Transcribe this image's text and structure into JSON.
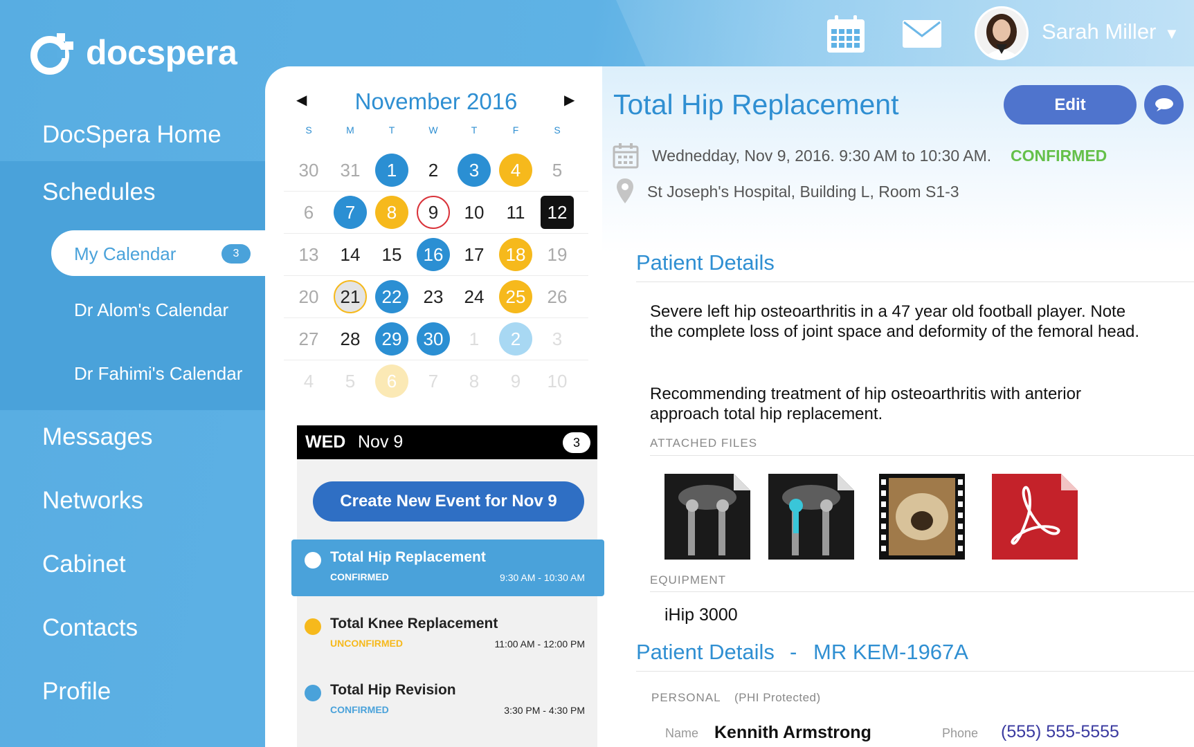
{
  "app": {
    "logo_text": "docspera"
  },
  "header": {
    "user_name": "Sarah Miller",
    "caret": "▼"
  },
  "sidebar": {
    "items": [
      {
        "label": "DocSpera Home"
      },
      {
        "label": "Schedules"
      },
      {
        "label": "Messages"
      },
      {
        "label": "Networks"
      },
      {
        "label": "Cabinet"
      },
      {
        "label": "Contacts"
      },
      {
        "label": "Profile"
      }
    ],
    "sub_items": [
      {
        "label": "My Calendar",
        "badge": "3"
      },
      {
        "label": "Dr Alom's Calendar"
      },
      {
        "label": "Dr Fahimi's Calendar"
      }
    ]
  },
  "calendar": {
    "title": "November 2016",
    "prev": "◀",
    "next": "▶",
    "weekdays": [
      "S",
      "M",
      "T",
      "W",
      "T",
      "F",
      "S"
    ],
    "weeks": [
      [
        {
          "d": "30",
          "s": "muted"
        },
        {
          "d": "31",
          "s": "muted"
        },
        {
          "d": "1",
          "s": "blue"
        },
        {
          "d": "2",
          "s": ""
        },
        {
          "d": "3",
          "s": "blue"
        },
        {
          "d": "4",
          "s": "yellow"
        },
        {
          "d": "5",
          "s": "muted"
        }
      ],
      [
        {
          "d": "6",
          "s": "muted"
        },
        {
          "d": "7",
          "s": "blue"
        },
        {
          "d": "8",
          "s": "yellow"
        },
        {
          "d": "9",
          "s": "redring"
        },
        {
          "d": "10",
          "s": ""
        },
        {
          "d": "11",
          "s": ""
        },
        {
          "d": "12",
          "s": "sel"
        }
      ],
      [
        {
          "d": "13",
          "s": "muted"
        },
        {
          "d": "14",
          "s": ""
        },
        {
          "d": "15",
          "s": ""
        },
        {
          "d": "16",
          "s": "blue"
        },
        {
          "d": "17",
          "s": ""
        },
        {
          "d": "18",
          "s": "yellow"
        },
        {
          "d": "19",
          "s": "muted"
        }
      ],
      [
        {
          "d": "20",
          "s": "muted"
        },
        {
          "d": "21",
          "s": "today"
        },
        {
          "d": "22",
          "s": "blue"
        },
        {
          "d": "23",
          "s": ""
        },
        {
          "d": "24",
          "s": ""
        },
        {
          "d": "25",
          "s": "yellow"
        },
        {
          "d": "26",
          "s": "muted"
        }
      ],
      [
        {
          "d": "27",
          "s": "muted"
        },
        {
          "d": "28",
          "s": ""
        },
        {
          "d": "29",
          "s": "blue"
        },
        {
          "d": "30",
          "s": "blue"
        },
        {
          "d": "1",
          "s": "faint"
        },
        {
          "d": "2",
          "s": "ltblue"
        },
        {
          "d": "3",
          "s": "faint"
        }
      ],
      [
        {
          "d": "4",
          "s": "faint"
        },
        {
          "d": "5",
          "s": "faint"
        },
        {
          "d": "6",
          "s": "ltyellow"
        },
        {
          "d": "7",
          "s": "faint"
        },
        {
          "d": "8",
          "s": "faint"
        },
        {
          "d": "9",
          "s": "faint"
        },
        {
          "d": "10",
          "s": "faint"
        }
      ]
    ]
  },
  "day_list": {
    "weekday": "WED",
    "date": "Nov 9",
    "count": "3",
    "create_label": "Create New Event for Nov 9",
    "events": [
      {
        "title": "Total Hip Replacement",
        "status": "CONFIRMED",
        "time": "9:30 AM - 10:30 AM",
        "dot_color": "#ffffff",
        "status_color": "#ffffff"
      },
      {
        "title": "Total Knee Replacement",
        "status": "UNCONFIRMED",
        "time": "11:00 AM - 12:00 PM",
        "dot_color": "#f6b91c",
        "status_color": "#f6b91c"
      },
      {
        "title": "Total Hip Revision",
        "status": "CONFIRMED",
        "time": "3:30 PM - 4:30 PM",
        "dot_color": "#4aa2da",
        "status_color": "#4aa2da"
      }
    ]
  },
  "detail": {
    "title": "Total Hip Replacement",
    "edit_label": "Edit",
    "date_text": "Wednedday, Nov 9, 2016.  9:30 AM to 10:30 AM.",
    "status": "CONFIRMED",
    "location": "St Joseph's Hospital, Building L, Room S1-3",
    "patient_details_title": "Patient Details",
    "para1": "Severe left hip osteoarthritis in a 47 year old football player. Note the complete loss of joint space and deformity of the femoral head.",
    "para2": "Recommending treatment of hip osteoarthritis with anterior approach total hip replacement.",
    "attached_files_caption": "ATTACHED FILES",
    "files": [
      "xray-file-icon",
      "xray-implant-file-icon",
      "ct-video-file-icon",
      "pdf-file-icon"
    ],
    "equipment_caption": "EQUIPMENT",
    "equipment": "iHip 3000",
    "patient_details_title2": "Patient Details",
    "dash": "-",
    "mr_number": "MR KEM-1967A",
    "personal_caption": "PERSONAL",
    "phi_note": "(PHI Protected)",
    "name_label": "Name",
    "name_value": "Kennith Armstrong",
    "phone_label": "Phone",
    "phone_value": "(555) 555-5555"
  },
  "colors": {
    "brand_blue": "#5aafe3",
    "accent_blue": "#2f8fd2",
    "confirmed_green": "#65c04a",
    "event_yellow": "#f6b91c",
    "button_indigo": "#4f74cd"
  }
}
